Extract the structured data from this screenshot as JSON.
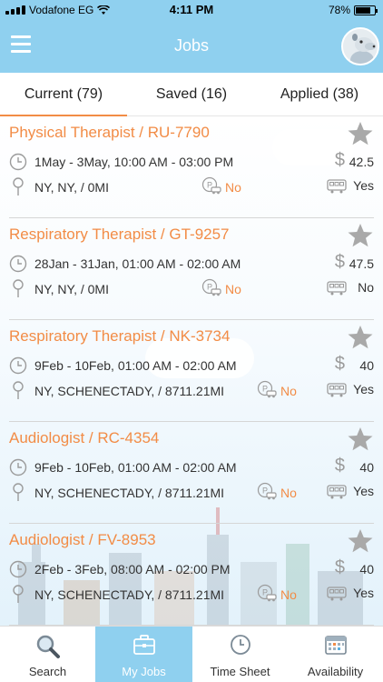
{
  "status_bar": {
    "carrier": "Vodafone EG",
    "time": "4:11 PM",
    "battery": "78%",
    "battery_level": 0.78
  },
  "header": {
    "title": "Jobs",
    "menu_icon": "hamburger-menu-icon",
    "avatar_icon": "user-avatar"
  },
  "tabs": [
    {
      "label": "Current (79)",
      "active": true
    },
    {
      "label": "Saved (16)",
      "active": false
    },
    {
      "label": "Applied (38)",
      "active": false
    }
  ],
  "jobs": [
    {
      "title": "Physical Therapist / RU-7790",
      "schedule": "1May - 3May, 10:00 AM  - 03:00 PM",
      "rate": "42.5",
      "location": "NY, NY,  / 0MI",
      "car": "No",
      "bus": "Yes"
    },
    {
      "title": "Respiratory Therapist / GT-9257",
      "schedule": "28Jan - 31Jan, 01:00 AM  - 02:00 AM",
      "rate": "47.5",
      "location": "NY, NY,  / 0MI",
      "car": "No",
      "bus": "No"
    },
    {
      "title": "Respiratory Therapist / NK-3734",
      "schedule": "9Feb - 10Feb, 01:00 AM  - 02:00 AM",
      "rate": "40",
      "location": "NY, SCHENECTADY,  / 8711.21MI",
      "car": "No",
      "bus": "Yes"
    },
    {
      "title": "Audiologist / RC-4354",
      "schedule": "9Feb - 10Feb, 01:00 AM  - 02:00 AM",
      "rate": "40",
      "location": "NY, SCHENECTADY,  / 8711.21MI",
      "car": "No",
      "bus": "Yes"
    },
    {
      "title": "Audiologist / FV-8953",
      "schedule": "2Feb - 3Feb, 08:00 AM  - 02:00 PM",
      "rate": "40",
      "location": "NY, SCHENECTADY,  / 8711.21MI",
      "car": "No",
      "bus": "Yes"
    }
  ],
  "icons": {
    "star": "star-icon",
    "clock": "clock-icon",
    "pin": "location-pin-icon",
    "dollar": "dollar-icon",
    "car": "car-icon",
    "bus": "bus-icon"
  },
  "bottom_nav": [
    {
      "label": "Search",
      "icon": "search-icon",
      "active": false
    },
    {
      "label": "My Jobs",
      "icon": "briefcase-icon",
      "active": true
    },
    {
      "label": "Time Sheet",
      "icon": "clock-icon",
      "active": false
    },
    {
      "label": "Availability",
      "icon": "calendar-icon",
      "active": false
    }
  ],
  "colors": {
    "header": "#8fd0ef",
    "accent": "#f28c46",
    "icon_gray": "#9b9b9b"
  }
}
